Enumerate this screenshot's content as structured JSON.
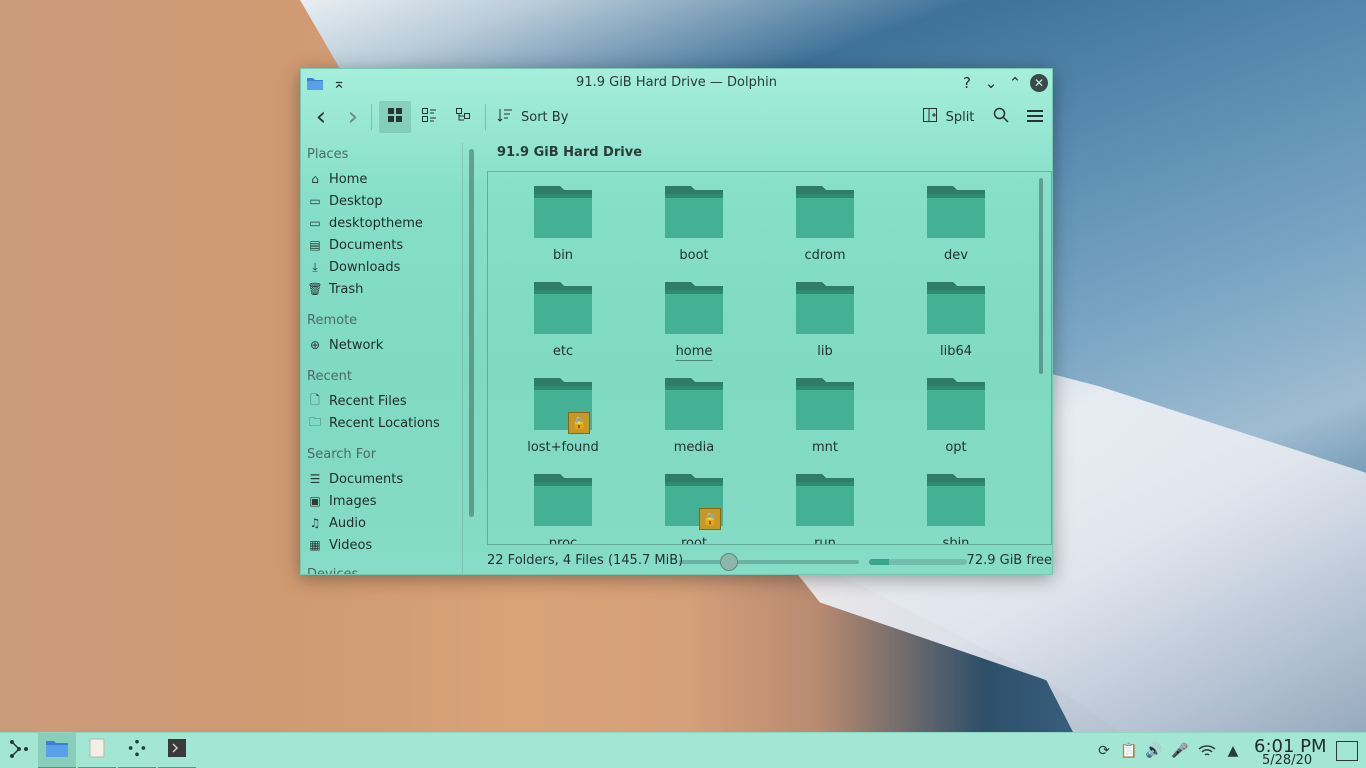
{
  "window": {
    "title": "91.9 GiB Hard Drive — Dolphin",
    "help": "?",
    "minimize": "⌄",
    "maximize": "⌃",
    "close": "✕",
    "shade": "⌅"
  },
  "toolbar": {
    "back": "‹",
    "forward": "›",
    "sort_by": "Sort By",
    "split": "Split"
  },
  "places": {
    "heading_places": "Places",
    "places": [
      {
        "label": "Home",
        "icon": "home-icon",
        "glyph": "⌂"
      },
      {
        "label": "Desktop",
        "icon": "desktop-icon",
        "glyph": "▭"
      },
      {
        "label": "desktoptheme",
        "icon": "folder-icon",
        "glyph": "▭"
      },
      {
        "label": "Documents",
        "icon": "documents-icon",
        "glyph": "▤"
      },
      {
        "label": "Downloads",
        "icon": "download-icon",
        "glyph": "⤓"
      },
      {
        "label": "Trash",
        "icon": "trash-icon",
        "glyph": "🗑"
      }
    ],
    "heading_remote": "Remote",
    "remote": [
      {
        "label": "Network",
        "icon": "network-icon",
        "glyph": "⊕"
      }
    ],
    "heading_recent": "Recent",
    "recent": [
      {
        "label": "Recent Files",
        "icon": "recent-files-icon",
        "glyph": "🗋"
      },
      {
        "label": "Recent Locations",
        "icon": "recent-locations-icon",
        "glyph": "🗀"
      }
    ],
    "heading_search": "Search For",
    "search": [
      {
        "label": "Documents",
        "icon": "search-documents-icon",
        "glyph": "☰"
      },
      {
        "label": "Images",
        "icon": "image-icon",
        "glyph": "▣"
      },
      {
        "label": "Audio",
        "icon": "audio-icon",
        "glyph": "♫"
      },
      {
        "label": "Videos",
        "icon": "video-icon",
        "glyph": "▦"
      }
    ],
    "heading_devices": "Devices"
  },
  "breadcrumb": "91.9 GiB Hard Drive",
  "folders": [
    {
      "name": "bin",
      "locked": false
    },
    {
      "name": "boot",
      "locked": false
    },
    {
      "name": "cdrom",
      "locked": false
    },
    {
      "name": "dev",
      "locked": false
    },
    {
      "name": "etc",
      "locked": false
    },
    {
      "name": "home",
      "locked": false,
      "hover": true
    },
    {
      "name": "lib",
      "locked": false
    },
    {
      "name": "lib64",
      "locked": false
    },
    {
      "name": "lost+found",
      "locked": true
    },
    {
      "name": "media",
      "locked": false
    },
    {
      "name": "mnt",
      "locked": false
    },
    {
      "name": "opt",
      "locked": false
    },
    {
      "name": "proc",
      "locked": false
    },
    {
      "name": "root",
      "locked": true
    },
    {
      "name": "run",
      "locked": false
    },
    {
      "name": "sbin",
      "locked": false
    }
  ],
  "status": {
    "summary": "22 Folders, 4 Files (145.7 MiB)",
    "zoom_level": 0.28,
    "used_fraction": 0.2,
    "free": "72.9 GiB free"
  },
  "taskbar": {
    "time": "6:01 PM",
    "date": "5/28/20"
  },
  "colors": {
    "accent": "#3aa58d",
    "folder": "#44b197",
    "lock": "#c79828"
  }
}
